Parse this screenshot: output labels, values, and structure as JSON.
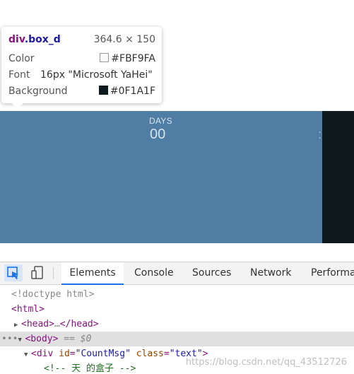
{
  "page": {
    "countdown": {
      "label": "DAYS",
      "value": "00",
      "separator": ":"
    },
    "colors": {
      "box_bg": "#4f7da3",
      "dark_bg": "#0F1A1F"
    }
  },
  "tooltip": {
    "tag": "div",
    "class_name": ".box_d",
    "size": "364.6 × 150",
    "color_label": "Color",
    "color_value": "#FBF9FA",
    "font_label": "Font",
    "font_value": "16px \"Microsoft YaHei\"",
    "background_label": "Background",
    "background_value": "#0F1A1F"
  },
  "devtools": {
    "tabs": [
      "Elements",
      "Console",
      "Sources",
      "Network",
      "Performa"
    ],
    "dom": {
      "doctype": "<!doctype html>",
      "html_open": "<html>",
      "head_open": "<head>",
      "head_ellipsis": "…",
      "head_close": "</head>",
      "body_open": "<body>",
      "body_marker": "== $0",
      "div_open": "<div",
      "div_id_attr": "id",
      "div_id_val": "\"CountMsg\"",
      "div_class_attr": "class",
      "div_class_val": "\"text\"",
      "div_close_bracket": ">",
      "comment": "<!-- 天 的盒子 -->"
    }
  },
  "watermark": "https://blog.csdn.net/qq_43512726"
}
